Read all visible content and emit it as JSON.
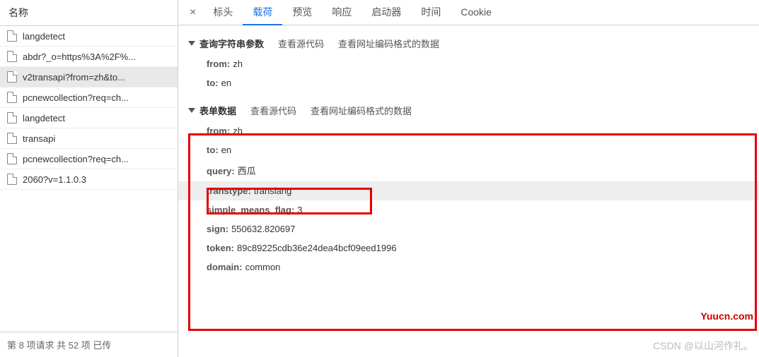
{
  "sidebar": {
    "header": "名称",
    "items": [
      {
        "label": "langdetect"
      },
      {
        "label": "abdr?_o=https%3A%2F%..."
      },
      {
        "label": "v2transapi?from=zh&to..."
      },
      {
        "label": "pcnewcollection?req=ch..."
      },
      {
        "label": "langdetect"
      },
      {
        "label": "transapi"
      },
      {
        "label": "pcnewcollection?req=ch..."
      },
      {
        "label": "2060?v=1.1.0.3"
      }
    ],
    "footer": "第 8 项请求    共 52 项    已传"
  },
  "tabs": {
    "close": "×",
    "items": [
      {
        "label": "标头"
      },
      {
        "label": "载荷"
      },
      {
        "label": "预览"
      },
      {
        "label": "响应"
      },
      {
        "label": "启动器"
      },
      {
        "label": "时间"
      },
      {
        "label": "Cookie"
      }
    ]
  },
  "query_section": {
    "title": "查询字符串参数",
    "link_source": "查看源代码",
    "link_encoded": "查看网址编码格式的数据",
    "rows": [
      {
        "key": "from:",
        "val": "zh"
      },
      {
        "key": "to:",
        "val": "en"
      }
    ]
  },
  "form_section": {
    "title": "表单数据",
    "link_source": "查看源代码",
    "link_encoded": "查看网址编码格式的数据",
    "rows": [
      {
        "key": "from:",
        "val": "zh"
      },
      {
        "key": "to:",
        "val": "en"
      },
      {
        "key": "query:",
        "val": "西瓜"
      },
      {
        "key": "transtype:",
        "val": "translang"
      },
      {
        "key": "simple_means_flag:",
        "val": "3"
      },
      {
        "key": "sign:",
        "val": "550632.820697"
      },
      {
        "key": "token:",
        "val": "89c89225cdb36e24dea4bcf09eed1996"
      },
      {
        "key": "domain:",
        "val": "common"
      }
    ]
  },
  "watermarks": {
    "red": "Yuucn.com",
    "grey": "CSDN @以山河作礼。"
  }
}
